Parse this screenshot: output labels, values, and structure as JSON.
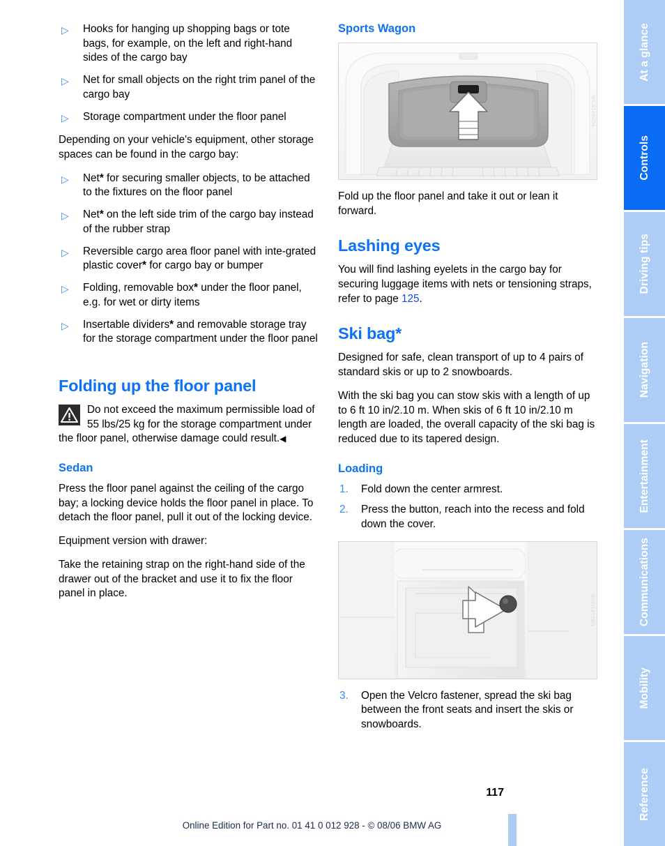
{
  "document": {
    "page_number": "117",
    "footer_text": "Online Edition for Part no. 01 41 0 012 928 - © 08/06 BMW AG",
    "accent_blue": "#0d72f5",
    "tab_blue": "#0a6cf5",
    "tab_blue_inactive": "#aecdf6"
  },
  "sidebar": {
    "tabs": [
      {
        "label": "At a glance",
        "active": false
      },
      {
        "label": "Controls",
        "active": true
      },
      {
        "label": "Driving tips",
        "active": false
      },
      {
        "label": "Navigation",
        "active": false
      },
      {
        "label": "Entertainment",
        "active": false
      },
      {
        "label": "Communications",
        "active": false
      },
      {
        "label": "Mobility",
        "active": false
      },
      {
        "label": "Reference",
        "active": false
      }
    ]
  },
  "left_column": {
    "bullets_top": [
      "Hooks for hanging up shopping bags or tote bags, for example, on the left and right-hand sides of the cargo bay",
      "Net for small objects on the right trim panel of the cargo bay",
      "Storage compartment under the floor panel"
    ],
    "intro_paragraph": "Depending on your vehicle's equipment, other storage spaces can be found in the cargo bay:",
    "bullets_equipment": [
      {
        "pre": "Net",
        "asterisk": "*",
        "post": " for securing smaller objects, to be attached to the fixtures on the floor panel"
      },
      {
        "pre": "Net",
        "asterisk": "*",
        "post": " on the left side trim of the cargo bay instead of the rubber strap"
      },
      {
        "pre": "Reversible cargo area floor panel with inte-grated plastic cover",
        "asterisk": "*",
        "post": " for cargo bay or bumper"
      },
      {
        "pre": "Folding, removable box",
        "asterisk": "*",
        "post": " under the floor panel, e.g. for wet or dirty items"
      },
      {
        "pre": "Insertable dividers",
        "asterisk": "*",
        "post": " and removable storage tray for the storage compartment under the floor panel"
      }
    ],
    "heading_folding": "Folding up the floor panel",
    "warning_text": "Do not exceed the maximum permissible load of 55 lbs/25 kg for the storage compartment under the floor panel, otherwise damage could result.",
    "warning_end_mark": "◀",
    "warning_icon": "warning-triangle-icon",
    "heading_sedan": "Sedan",
    "sedan_paragraph_1": "Press the floor panel against the ceiling of the cargo bay; a locking device holds the floor panel in place. To detach the floor panel, pull it out of the locking device.",
    "sedan_paragraph_2": "Equipment version with drawer:",
    "sedan_paragraph_3": "Take the retaining strap on the right-hand side of the drawer out of the bracket and use it to fix the floor panel in place."
  },
  "right_column": {
    "heading_sports_wagon": "Sports Wagon",
    "figure_cargo_bay": {
      "name": "cargo-bay-floor-panel-illustration",
      "id_text": "WCN14BA04"
    },
    "sports_wagon_paragraph": "Fold up the floor panel and take it out or lean it forward.",
    "heading_lashing": "Lashing eyes",
    "lashing_paragraph_pre": "You will find lashing eyelets in the cargo bay for securing luggage items with nets or tensioning straps, refer to page ",
    "lashing_page_ref": "125",
    "lashing_paragraph_post": ".",
    "heading_ski_bag": "Ski bag*",
    "ski_paragraph_1": "Designed for safe, clean transport of up to 4 pairs of standard skis or up to 2 snowboards.",
    "ski_paragraph_2": "With the ski bag you can stow skis with a length of up to 6 ft 10 in/2.10 m. When skis of 6 ft 10 in/2.10 m length are loaded, the overall capacity of the ski bag is reduced due to its tapered design.",
    "heading_loading": "Loading",
    "loading_steps": [
      {
        "number": "1.",
        "text": "Fold down the center armrest."
      },
      {
        "number": "2.",
        "text": "Press the button, reach into the recess and fold down the cover."
      }
    ],
    "figure_armrest": {
      "name": "armrest-cover-button-illustration",
      "id_text": "WCN14TCM1"
    },
    "loading_step_3": {
      "number": "3.",
      "text": "Open the Velcro fastener, spread the ski bag between the front seats and insert the skis or snowboards."
    }
  }
}
